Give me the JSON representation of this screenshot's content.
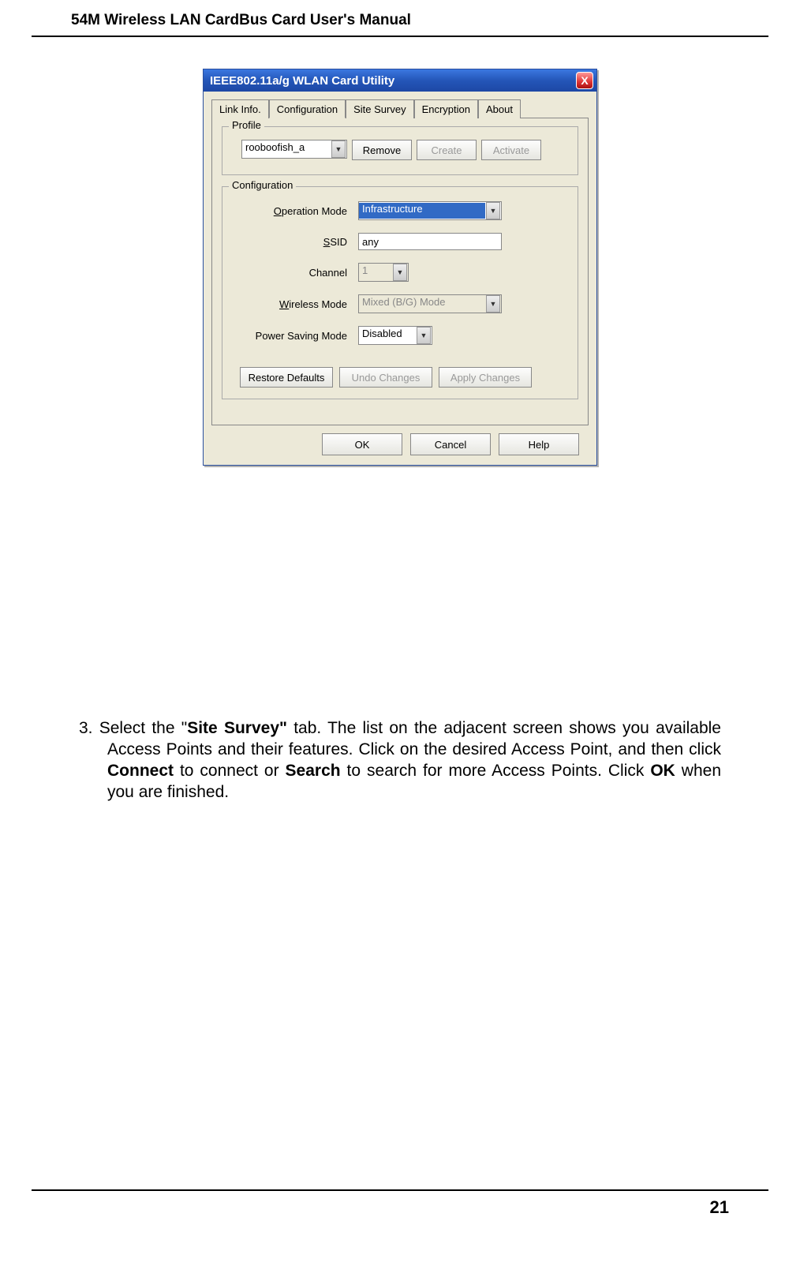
{
  "page": {
    "header": "54M Wireless LAN CardBus Card User's Manual",
    "footer_number": "21"
  },
  "dialog": {
    "title": "IEEE802.11a/g WLAN Card Utility",
    "close_symbol": "X",
    "tabs": {
      "link_info": "Link Info.",
      "configuration": "Configuration",
      "site_survey": "Site Survey",
      "encryption": "Encryption",
      "about": "About"
    },
    "profile": {
      "legend": "Profile",
      "combo_value": "rooboofish_a",
      "remove": "Remove",
      "create": "Create",
      "activate": "Activate"
    },
    "configuration": {
      "legend": "Configuration",
      "labels": {
        "operation_mode": "peration Mode",
        "ssid": "SID",
        "channel": "Channel",
        "wireless_mode": "ireless Mode",
        "power_saving_mode": "Power Saving Mode"
      },
      "values": {
        "operation_mode": "Infrastructure",
        "ssid": "any",
        "channel": "1",
        "wireless_mode": "Mixed (B/G) Mode",
        "power_saving_mode": "Disabled"
      },
      "buttons": {
        "restore": "Restore Defaults",
        "undo": "Undo Changes",
        "apply": "Apply Changes"
      }
    },
    "buttons": {
      "ok": "OK",
      "cancel": "Cancel",
      "help": "Help"
    }
  },
  "instruction": {
    "number": "3.",
    "pre_bold1": "  Select the \"",
    "bold1": "Site Survey\"",
    "mid1": " tab. The list on the adjacent screen shows you available Access Points and their features. Click on the desired Access Point, and then click ",
    "bold2": "Connect",
    "mid2": " to connect or ",
    "bold3": "Search",
    "mid3": " to search for more Access Points. Click ",
    "bold4": "OK",
    "mid4": " when you are finished."
  }
}
